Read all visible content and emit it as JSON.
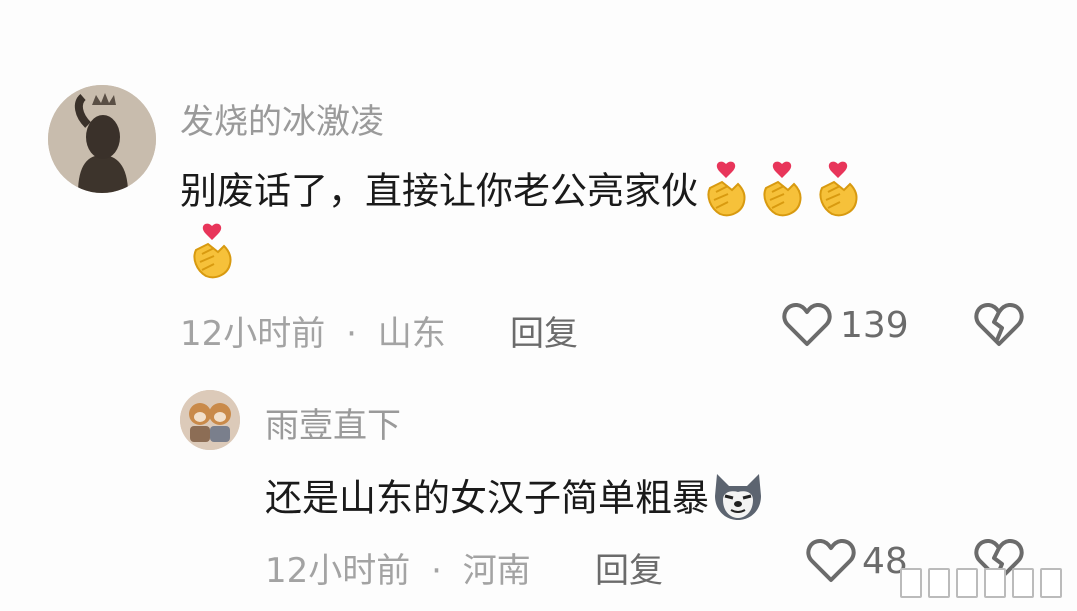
{
  "comments": [
    {
      "username": "发烧的冰激凌",
      "text": "别废话了，直接让你老公亮家伙",
      "time": "12小时前",
      "location": "山东",
      "reply_label": "回复",
      "likes": "139",
      "emoji_icons": [
        "finger-heart-icon",
        "finger-heart-icon",
        "finger-heart-icon",
        "finger-heart-icon"
      ]
    },
    {
      "username": "雨壹直下",
      "text": "还是山东的女汉子简单粗暴",
      "time": "12小时前",
      "location": "河南",
      "reply_label": "回复",
      "likes": "48",
      "emoji_icons": [
        "husky-dog-icon"
      ]
    }
  ],
  "separator": "·"
}
